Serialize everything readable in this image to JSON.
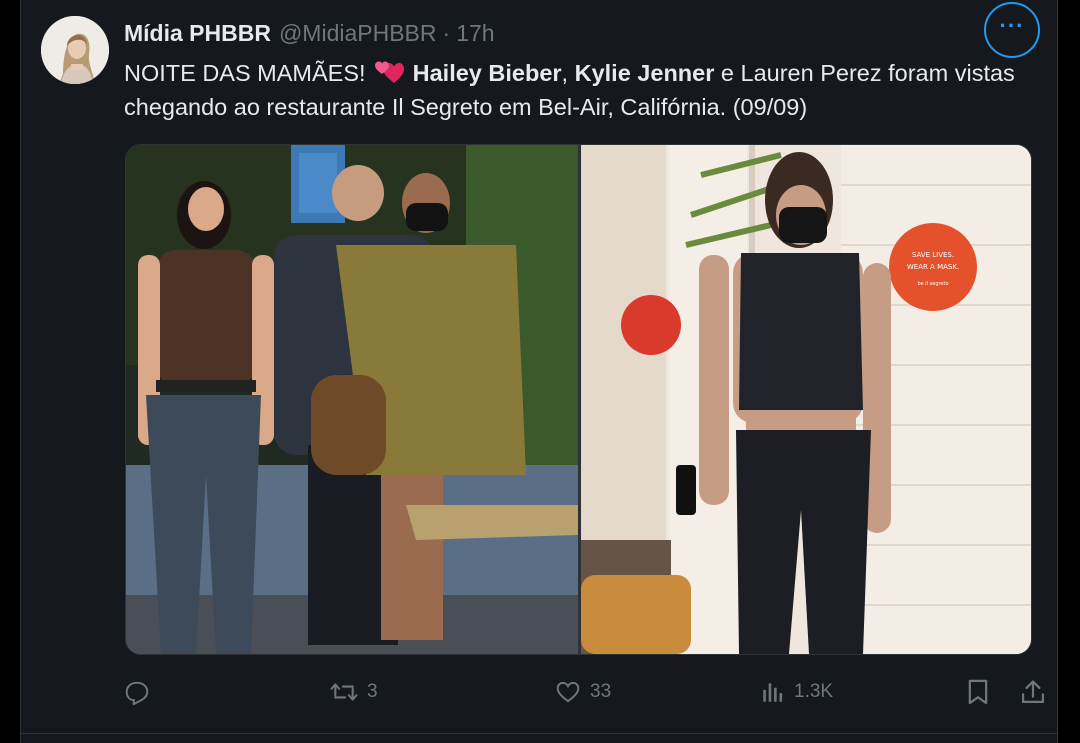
{
  "tweet": {
    "display_name": "Mídia PHBBR",
    "handle": "@MidiaPHBBR",
    "separator": "·",
    "time": "17h",
    "more_label": "···",
    "text": {
      "intro": "NOITE DAS MAMÃES!",
      "emoji": "two-hearts",
      "name1": "Hailey Bieber",
      "comma": ",",
      "name2": "Kylie Jenner",
      "rest": "e Lauren Perez foram vistas chegando ao restaurante Il Segreto em Bel-Air, Califórnia. (09/09)"
    },
    "photo_right_sign": {
      "line1": "SAVE LIVES.",
      "line2": "WEAR A MASK.",
      "line3": "be il segreto"
    },
    "actions": {
      "reply_icon": "reply-icon",
      "retweet_count": "3",
      "like_count": "33",
      "views_count": "1.3K",
      "bookmark_icon": "bookmark-icon",
      "share_icon": "share-icon"
    },
    "colors": {
      "background": "#15181c",
      "text": "#e7e9ea",
      "secondary": "#71767b",
      "accent": "#1d9bf0",
      "heart_emoji": "#e0245e"
    }
  }
}
